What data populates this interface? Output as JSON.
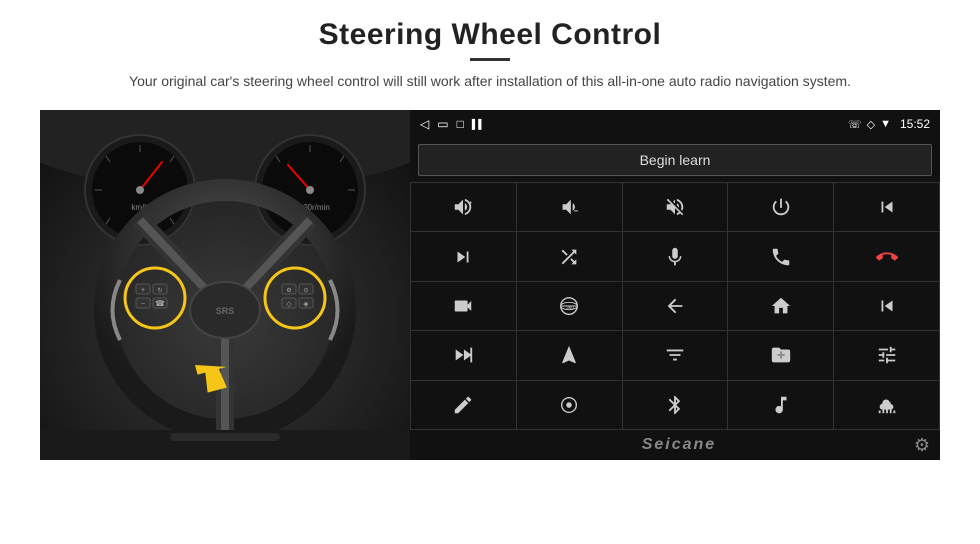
{
  "header": {
    "title": "Steering Wheel Control",
    "divider": true,
    "subtitle": "Your original car's steering wheel control will still work after installation of this all-in-one auto radio navigation system."
  },
  "android_ui": {
    "status_bar": {
      "back_icon": "◁",
      "home_icon": "⬜",
      "recent_icon": "◻",
      "signal_icon": "▌▌",
      "phone_icon": "📞",
      "location_icon": "⬥",
      "wifi_icon": "▾",
      "time": "15:52"
    },
    "begin_learn_button": "Begin learn",
    "grid_rows": [
      [
        {
          "icon": "vol_up",
          "unicode": "🔊+",
          "label": "Volume Up"
        },
        {
          "icon": "vol_down",
          "unicode": "🔉−",
          "label": "Volume Down"
        },
        {
          "icon": "vol_mute",
          "unicode": "🔇",
          "label": "Mute"
        },
        {
          "icon": "power",
          "unicode": "⏻",
          "label": "Power"
        },
        {
          "icon": "prev_track",
          "unicode": "⏮",
          "label": "Prev Track"
        }
      ],
      [
        {
          "icon": "next_track",
          "unicode": "⏭",
          "label": "Next Track"
        },
        {
          "icon": "shuffle",
          "unicode": "⇄⏩",
          "label": "Shuffle"
        },
        {
          "icon": "microphone",
          "unicode": "🎤",
          "label": "Microphone"
        },
        {
          "icon": "phone",
          "unicode": "📞",
          "label": "Phone"
        },
        {
          "icon": "hang_up",
          "unicode": "📵",
          "label": "Hang Up"
        }
      ],
      [
        {
          "icon": "camera",
          "unicode": "📷",
          "label": "Camera"
        },
        {
          "icon": "360",
          "unicode": "👁360",
          "label": "360 View"
        },
        {
          "icon": "back",
          "unicode": "↩",
          "label": "Back"
        },
        {
          "icon": "home",
          "unicode": "⌂",
          "label": "Home"
        },
        {
          "icon": "skip_back",
          "unicode": "⏮⏮",
          "label": "Skip Back"
        }
      ],
      [
        {
          "icon": "fast_forward",
          "unicode": "⏩⏩",
          "label": "Fast Forward"
        },
        {
          "icon": "navigation",
          "unicode": "▲",
          "label": "Navigation"
        },
        {
          "icon": "equalizer",
          "unicode": "⇌",
          "label": "Equalizer"
        },
        {
          "icon": "folder",
          "unicode": "📁",
          "label": "Folder"
        },
        {
          "icon": "settings_sliders",
          "unicode": "⚙",
          "label": "Sliders"
        }
      ],
      [
        {
          "icon": "pen",
          "unicode": "✏",
          "label": "Pen"
        },
        {
          "icon": "circle_dot",
          "unicode": "◎",
          "label": "Circle"
        },
        {
          "icon": "bluetooth",
          "unicode": "⚡",
          "label": "Bluetooth"
        },
        {
          "icon": "music",
          "unicode": "♫",
          "label": "Music"
        },
        {
          "icon": "sound_wave",
          "unicode": "〰",
          "label": "Sound Wave"
        }
      ]
    ],
    "brand": "Seicane",
    "gear_icon": "⚙"
  },
  "icons": {
    "vol_up_char": "⊕",
    "vol_down_char": "⊖",
    "mute_char": "×",
    "power_char": "⏻",
    "prev_char": "⏮",
    "next_char": "⏭",
    "shuffle_char": "⇄",
    "mic_char": "🎙",
    "phone_char": "☎",
    "hangup_char": "✆",
    "cam_char": "📸",
    "circle360_char": "⊚",
    "back_char": "↺",
    "home_char": "⌂",
    "rw_char": "⏮",
    "ff_char": "⏭",
    "nav_char": "➤",
    "eq_char": "⇌",
    "folder_char": "🗁",
    "slider_char": "⛶",
    "pen_char": "✎",
    "dot_char": "◉",
    "bt_char": "ʙ",
    "music_char": "♪",
    "wave_char": "≋"
  }
}
